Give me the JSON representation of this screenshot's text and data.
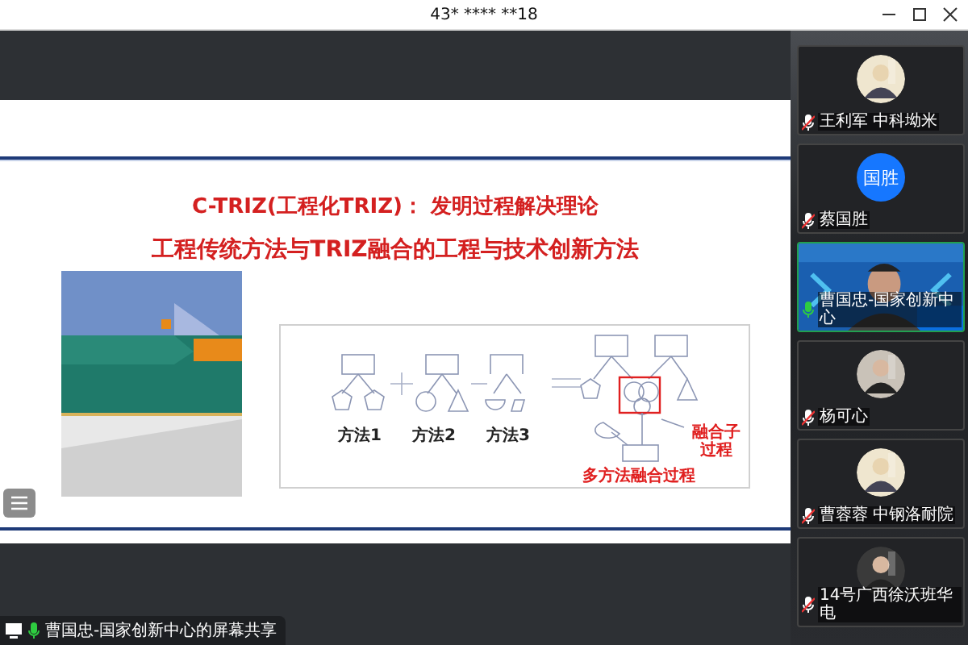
{
  "window": {
    "title": "43* **** **18"
  },
  "slide": {
    "title_lines": [
      "C-TRIZ(工程化TRIZ)： 发明过程解决理论",
      "工程传统方法与TRIZ融合的工程与技术创新方法"
    ],
    "book_cover": {
      "kind": "picture"
    },
    "diagram": {
      "method_labels": [
        "方法1",
        "方法2",
        "方法3"
      ],
      "fusion_label": [
        "融合子",
        "过程"
      ],
      "result_label": "多方法融合过程"
    }
  },
  "participants": [
    {
      "name": "王利军 中科坳米",
      "kind": "picture",
      "muted": true,
      "speaking": false
    },
    {
      "name": "蔡国胜",
      "kind": "initials",
      "initials": "国胜",
      "muted": true,
      "speaking": false
    },
    {
      "name": "曹国忠-国家创新中心",
      "kind": "video",
      "muted": false,
      "speaking": true
    },
    {
      "name": "杨可心",
      "kind": "picture",
      "muted": true,
      "speaking": false
    },
    {
      "name": "曹蓉蓉 中钢洛耐院",
      "kind": "picture",
      "muted": true,
      "speaking": false
    },
    {
      "name": "14号广西徐沃班华电",
      "kind": "picture",
      "muted": true,
      "speaking": false
    }
  ],
  "share_label": {
    "text": "曹国忠-国家创新中心的屏幕共享",
    "muted": false
  }
}
